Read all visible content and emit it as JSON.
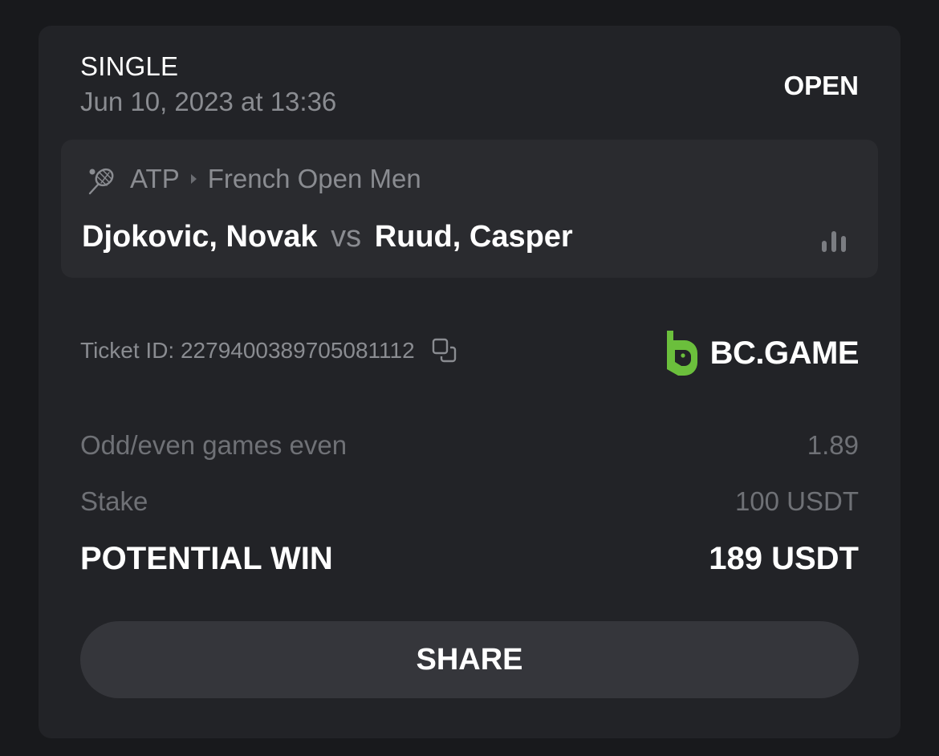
{
  "bet": {
    "type": "SINGLE",
    "date": "Jun 10, 2023 at 13:36",
    "status": "OPEN"
  },
  "event": {
    "sport_icon": "tennis-racket-icon",
    "tournament_group": "ATP",
    "tournament": "French Open Men",
    "home": "Djokovic, Novak",
    "vs": "vs",
    "away": "Ruud, Casper",
    "stats_icon": "bar-chart-icon"
  },
  "ticket": {
    "label": "Ticket ID: 2279400389705081112",
    "copy_icon": "copy-icon"
  },
  "brand": {
    "name": "BC.GAME",
    "color": "#6bbf3c"
  },
  "selection": {
    "market": "Odd/even games even",
    "odds": "1.89"
  },
  "stake": {
    "label": "Stake",
    "value": "100 USDT"
  },
  "potential_win": {
    "label": "POTENTIAL WIN",
    "value": "189 USDT"
  },
  "actions": {
    "share_label": "SHARE"
  },
  "colors": {
    "background": "#18191c",
    "card": "#222327",
    "event_box": "#2a2b2f",
    "muted_text": "#8a8c91",
    "button": "#35363b"
  }
}
